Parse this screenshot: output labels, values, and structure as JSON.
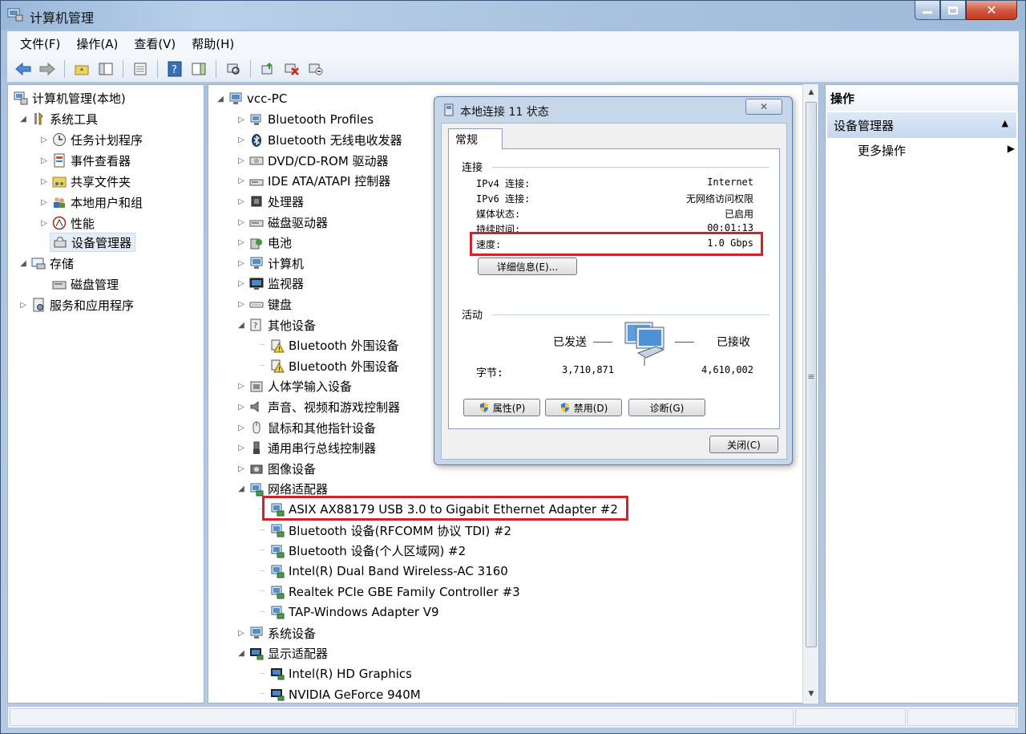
{
  "window": {
    "title": "计算机管理"
  },
  "menubar": {
    "items": [
      "文件(F)",
      "操作(A)",
      "查看(V)",
      "帮助(H)"
    ]
  },
  "toolbar": {
    "icons": [
      "back-arrow-icon",
      "forward-arrow-icon",
      "folder-up-icon",
      "show-hide-tree-icon",
      "properties-icon",
      "help-icon",
      "action-pane-icon",
      "scan-hardware-icon",
      "update-driver-icon",
      "uninstall-icon",
      "disable-icon"
    ]
  },
  "left_tree": {
    "root": "计算机管理(本地)",
    "system_tools": "系统工具",
    "task_scheduler": "任务计划程序",
    "event_viewer": "事件查看器",
    "shared_folders": "共享文件夹",
    "local_users": "本地用户和组",
    "performance": "性能",
    "device_manager": "设备管理器",
    "storage": "存储",
    "disk_management": "磁盘管理",
    "services": "服务和应用程序"
  },
  "device_tree": {
    "computer_name": "vcc-PC",
    "items": [
      "Bluetooth Profiles",
      "Bluetooth 无线电收发器",
      "DVD/CD-ROM 驱动器",
      "IDE ATA/ATAPI 控制器",
      "处理器",
      "磁盘驱动器",
      "电池",
      "计算机",
      "监视器",
      "键盘",
      "其他设备",
      "Bluetooth 外围设备",
      "Bluetooth 外围设备",
      "人体学输入设备",
      "声音、视频和游戏控制器",
      "鼠标和其他指针设备",
      "通用串行总线控制器",
      "图像设备",
      "网络适配器",
      "ASIX AX88179 USB 3.0 to Gigabit Ethernet Adapter #2",
      "Bluetooth 设备(RFCOMM 协议 TDI) #2",
      "Bluetooth 设备(个人区域网) #2",
      "Intel(R) Dual Band Wireless-AC 3160",
      "Realtek PCIe GBE Family Controller #3",
      "TAP-Windows Adapter V9",
      "系统设备",
      "显示适配器",
      "Intel(R) HD Graphics",
      "NVIDIA GeForce 940M"
    ]
  },
  "actions": {
    "header": "操作",
    "device_manager": "设备管理器",
    "more": "更多操作"
  },
  "dialog": {
    "title": "本地连接 11 状态",
    "close_glyph": "✕",
    "tab": "常规",
    "connection_group": "连接",
    "ipv4_label": "IPv4 连接:",
    "ipv4_value": "Internet",
    "ipv6_label": "IPv6 连接:",
    "ipv6_value": "无网络访问权限",
    "media_label": "媒体状态:",
    "media_value": "已启用",
    "duration_label": "持续时间:",
    "duration_value": "00:01:13",
    "speed_label": "速度:",
    "speed_value": "1.0 Gbps",
    "details_button": "详细信息(E)...",
    "activity_group": "活动",
    "sent_label": "已发送",
    "received_label": "已接收",
    "bytes_label": "字节:",
    "bytes_sent": "3,710,871",
    "bytes_received": "4,610,002",
    "properties_button": "属性(P)",
    "disable_button": "禁用(D)",
    "diagnose_button": "诊断(G)",
    "close_button": "关闭(C)"
  },
  "highlight_color": "#d7202a"
}
